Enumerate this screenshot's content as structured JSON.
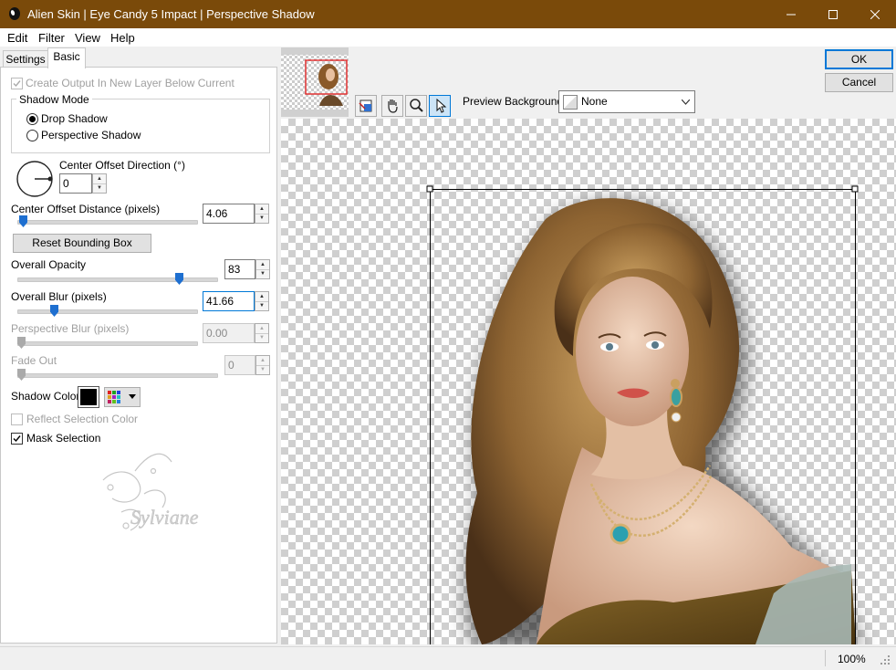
{
  "window": {
    "title": "Alien Skin | Eye Candy 5 Impact | Perspective Shadow",
    "minimize_icon": "minimize-icon",
    "maximize_icon": "maximize-icon",
    "close_icon": "close-icon",
    "title_bar_color": "#7a4a0a"
  },
  "menu": {
    "edit": "Edit",
    "filter": "Filter",
    "view": "View",
    "help": "Help"
  },
  "tabs": [
    "Settings",
    "Basic"
  ],
  "basic": {
    "create_output_label": "Create Output In New Layer Below Current",
    "create_output_checked": true,
    "shadow_mode": {
      "title": "Shadow Mode",
      "options": [
        "Drop Shadow",
        "Perspective Shadow"
      ],
      "selected": "Drop Shadow"
    },
    "center_offset_direction": {
      "label": "Center Offset Direction (°)",
      "value": "0"
    },
    "center_offset_distance": {
      "label": "Center Offset Distance (pixels)",
      "value": "4.06"
    },
    "reset_bounding_box": "Reset Bounding Box",
    "overall_opacity": {
      "label": "Overall Opacity",
      "value": "83"
    },
    "overall_blur": {
      "label": "Overall Blur (pixels)",
      "value": "41.66"
    },
    "perspective_blur": {
      "label": "Perspective Blur (pixels)",
      "value": "0.00"
    },
    "fade_out": {
      "label": "Fade Out",
      "value": "0"
    },
    "shadow_color": {
      "label": "Shadow Color",
      "color": "#000000"
    },
    "reflect_selection_color": {
      "label": "Reflect Selection Color",
      "checked": false
    },
    "mask_selection": {
      "label": "Mask Selection",
      "checked": true
    },
    "watermark_text": "Sylviane"
  },
  "buttons": {
    "ok": "OK",
    "cancel": "Cancel"
  },
  "toolbar": {
    "tools": [
      "preview-navigator-icon",
      "hand-tool-icon",
      "zoom-tool-icon",
      "pointer-tool-icon"
    ],
    "preview_background_label": "Preview Background:",
    "preview_background_value": "None"
  },
  "status": {
    "zoom": "100%"
  },
  "colors": {
    "accent": "#0078d7",
    "slider_thumb": "#1e6fd0"
  }
}
